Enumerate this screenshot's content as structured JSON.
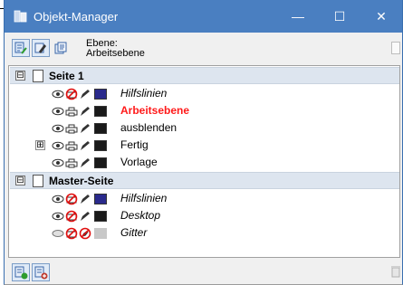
{
  "window": {
    "title": "Objekt-Manager",
    "controls": {
      "minimize": "—",
      "maximize": "☐",
      "close": "✕"
    }
  },
  "toolbar": {
    "layer_caption_1": "Ebene:",
    "layer_caption_2": "Arbeitsebene"
  },
  "pages": [
    {
      "label": "Seite 1",
      "expander": "⊟",
      "layers": [
        {
          "label": "Hilfslinien",
          "style": "italic",
          "color": "#2a2a8c"
        },
        {
          "label": "Arbeitsebene",
          "style": "active",
          "color": "#1a1a1a"
        },
        {
          "label": "ausblenden",
          "style": "normal",
          "color": "#1a1a1a"
        },
        {
          "label": "Fertig",
          "style": "normal",
          "color": "#1a1a1a",
          "expander": "⊞"
        },
        {
          "label": "Vorlage",
          "style": "normal",
          "color": "#1a1a1a"
        }
      ]
    },
    {
      "label": "Master-Seite",
      "expander": "⊟",
      "layers": [
        {
          "label": "Hilfslinien",
          "style": "italic",
          "color": "#2a2a8c"
        },
        {
          "label": "Desktop",
          "style": "italic",
          "color": "#1a1a1a"
        },
        {
          "label": "Gitter",
          "style": "italic",
          "color": "#c8c8c8"
        }
      ]
    }
  ],
  "colors": {
    "titlebar": "#4a7fc1",
    "active_layer_text": "#ff1a1a",
    "page_row_bg": "#dde5ef"
  }
}
